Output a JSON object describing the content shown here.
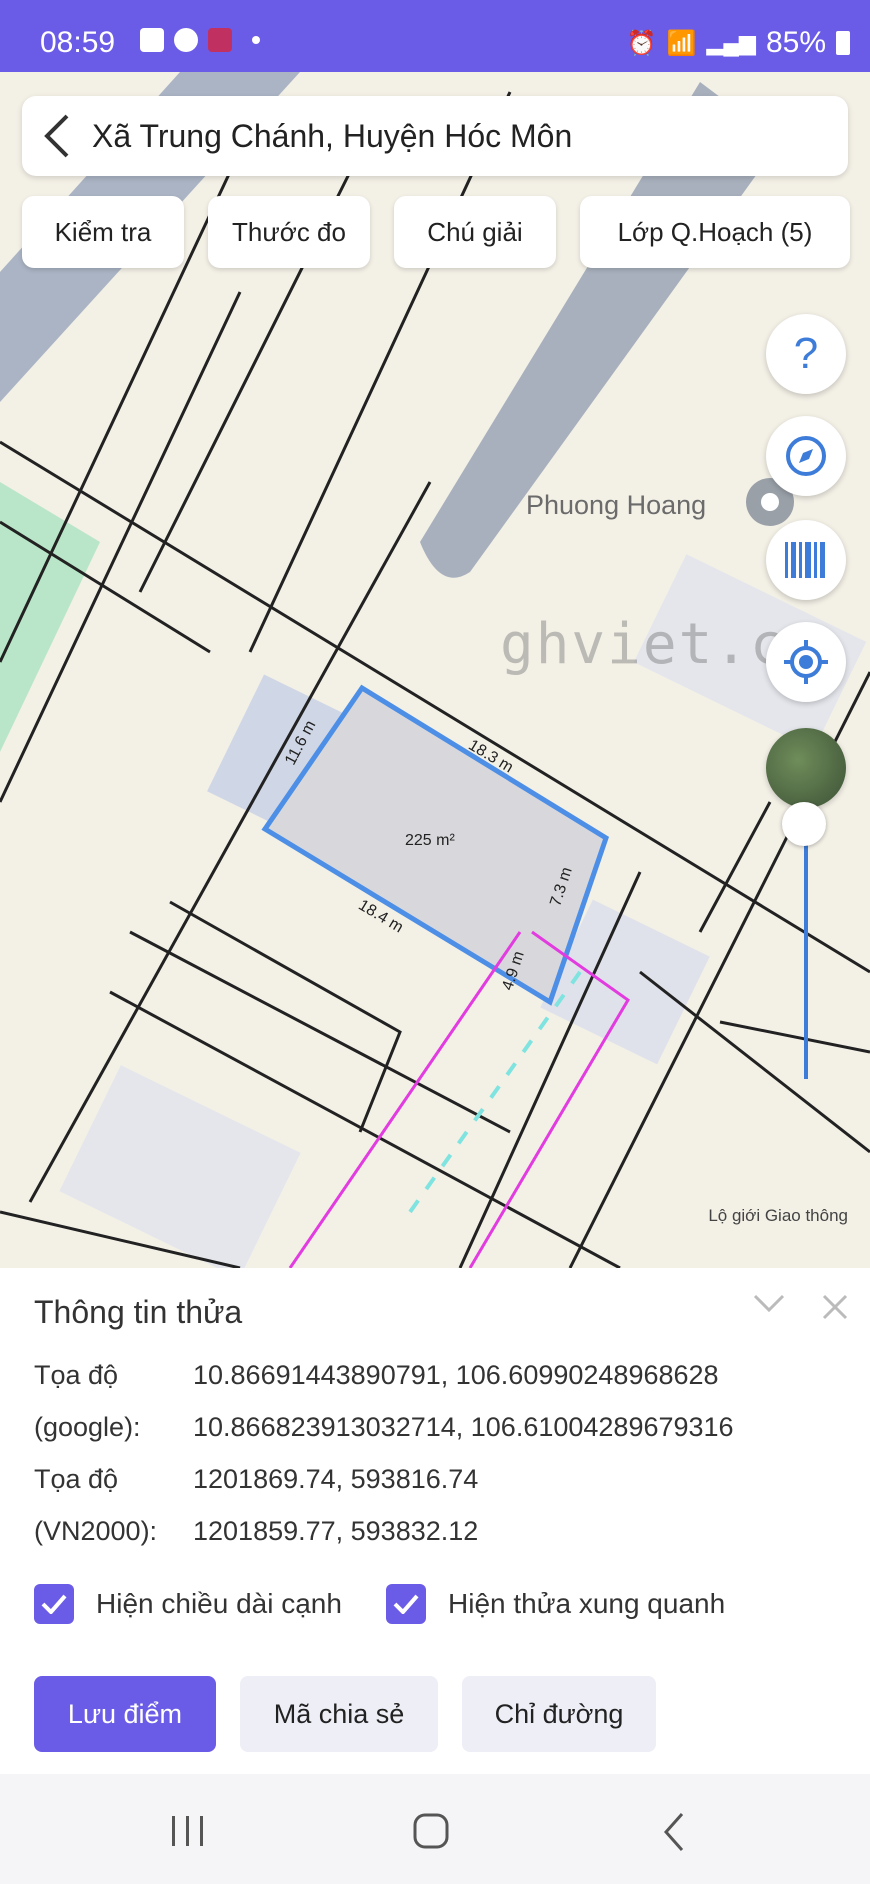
{
  "status_bar": {
    "time": "08:59",
    "battery": "85%"
  },
  "header": {
    "title": "Xã Trung Chánh, Huyện Hóc Môn"
  },
  "toolbar": {
    "chips": [
      "Kiểm tra",
      "Thước đo",
      "Chú giải",
      "Lớp Q.Hoạch (5)"
    ]
  },
  "map": {
    "place_label": "Phuong Hoang",
    "watermark": "ghviet.c",
    "area_label": "225 m²",
    "edges": [
      "11.6 m",
      "18.3 m",
      "7.3 m",
      "4.9 m",
      "18.4 m"
    ],
    "attribution": "Lộ giới Giao thông",
    "colors": {
      "parcel": "#4d8fe6",
      "planning": "#e23be0",
      "road_dash": "#7fe3e0"
    }
  },
  "panel": {
    "title": "Thông tin thửa",
    "rows": [
      {
        "label": "Tọa độ",
        "value": "10.86691443890791, 106.60990248968628"
      },
      {
        "label": "(google):",
        "value": "10.866823913032714, 106.61004289679316"
      },
      {
        "label": "Tọa độ",
        "value": "1201869.74, 593816.74"
      },
      {
        "label": "(VN2000):",
        "value": "1201859.77, 593832.12"
      }
    ],
    "checkboxes": [
      {
        "label": "Hiện chiều dài cạnh",
        "checked": true
      },
      {
        "label": "Hiện thửa xung quanh",
        "checked": true
      }
    ],
    "buttons": {
      "save": "Lưu điểm",
      "share": "Mã chia sẻ",
      "directions": "Chỉ đường"
    }
  },
  "theme": {
    "accent": "#6b5ce7"
  }
}
